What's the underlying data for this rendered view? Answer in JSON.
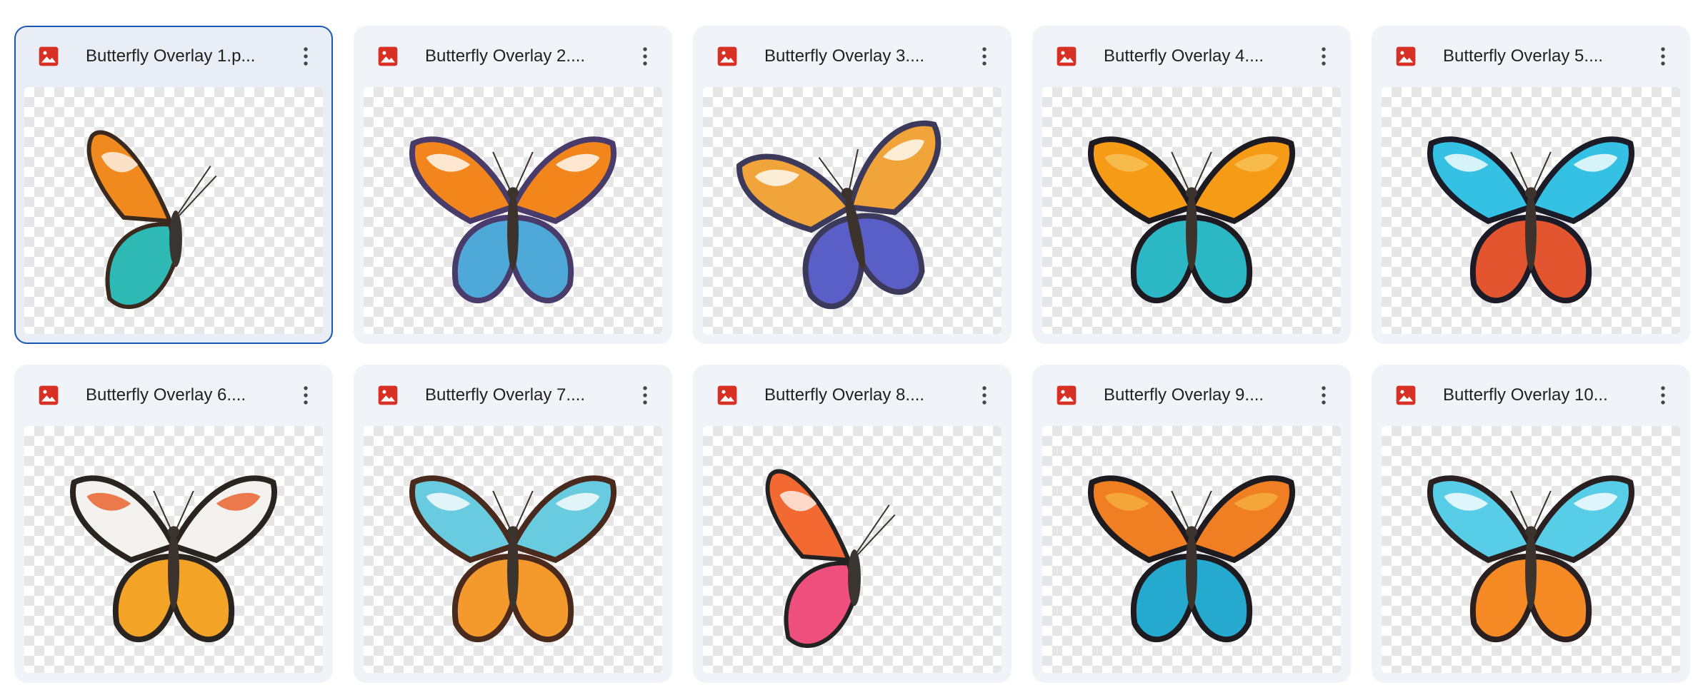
{
  "files": [
    {
      "name": "Butterfly Overlay 1.p...",
      "selected": true,
      "icon": "image-file-icon",
      "variant": "side",
      "colors": {
        "a": "#f08a1e",
        "b": "#2fb9b5",
        "c": "#ffffff",
        "edge": "#3a2a1e"
      }
    },
    {
      "name": "Butterfly Overlay 2....",
      "selected": false,
      "icon": "image-file-icon",
      "variant": "open",
      "colors": {
        "a": "#f2861c",
        "b": "#4ea8d8",
        "c": "#ffffff",
        "edge": "#4a3c6a"
      }
    },
    {
      "name": "Butterfly Overlay 3....",
      "selected": false,
      "icon": "image-file-icon",
      "variant": "tilted",
      "colors": {
        "a": "#f1a43a",
        "b": "#5a5fc8",
        "c": "#ffffff",
        "edge": "#3c3a5a"
      }
    },
    {
      "name": "Butterfly Overlay 4....",
      "selected": false,
      "icon": "image-file-icon",
      "variant": "open",
      "colors": {
        "a": "#f59b16",
        "b": "#2bb8c4",
        "c": "#f8c35a",
        "edge": "#1e1a22"
      }
    },
    {
      "name": "Butterfly Overlay 5....",
      "selected": false,
      "icon": "image-file-icon",
      "variant": "open",
      "colors": {
        "a": "#34c1e3",
        "b": "#e3552e",
        "c": "#ffffff",
        "edge": "#1c1c28"
      }
    },
    {
      "name": "Butterfly Overlay 6....",
      "selected": false,
      "icon": "image-file-icon",
      "variant": "open",
      "colors": {
        "a": "#f4f2ee",
        "b": "#f3a326",
        "c": "#e85a22",
        "edge": "#2a2420"
      }
    },
    {
      "name": "Butterfly Overlay 7....",
      "selected": false,
      "icon": "image-file-icon",
      "variant": "open",
      "colors": {
        "a": "#69cbe0",
        "b": "#f49a2c",
        "c": "#ffffff",
        "edge": "#4a2a1c"
      }
    },
    {
      "name": "Butterfly Overlay 8....",
      "selected": false,
      "icon": "image-file-icon",
      "variant": "side",
      "colors": {
        "a": "#f26a32",
        "b": "#ef4f7c",
        "c": "#ffffff",
        "edge": "#222222"
      }
    },
    {
      "name": "Butterfly Overlay 9....",
      "selected": false,
      "icon": "image-file-icon",
      "variant": "open",
      "colors": {
        "a": "#f07e22",
        "b": "#26a9cf",
        "c": "#f6b040",
        "edge": "#1d1b20"
      }
    },
    {
      "name": "Butterfly Overlay 10...",
      "selected": false,
      "icon": "image-file-icon",
      "variant": "open",
      "colors": {
        "a": "#58cde8",
        "b": "#f58a24",
        "c": "#ffffff",
        "edge": "#2a2020"
      }
    }
  ],
  "icon_color": "#d93025",
  "accent_color": "#1a56b4"
}
